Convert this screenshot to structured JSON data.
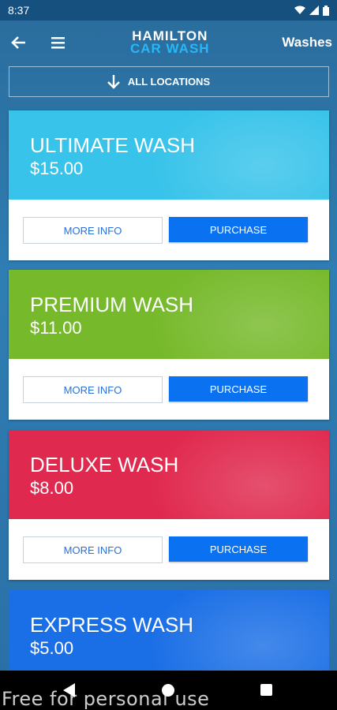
{
  "status": {
    "time": "8:37"
  },
  "header": {
    "logo_line1": "HAMILTON",
    "logo_line2": "CAR WASH",
    "title": "Washes"
  },
  "location": {
    "label": "ALL LOCATIONS"
  },
  "washes": [
    {
      "name": "ULTIMATE WASH",
      "price": "$15.00",
      "color": "#37c3ea",
      "more_label": "MORE INFO",
      "buy_label": "PURCHASE"
    },
    {
      "name": "PREMIUM WASH",
      "price": "$11.00",
      "color": "#76b92a",
      "more_label": "MORE INFO",
      "buy_label": "PURCHASE"
    },
    {
      "name": "DELUXE WASH",
      "price": "$8.00",
      "color": "#e0294e",
      "more_label": "MORE INFO",
      "buy_label": "PURCHASE"
    },
    {
      "name": "EXPRESS WASH",
      "price": "$5.00",
      "color": "#1b6fe6"
    }
  ],
  "icons": {
    "back": "arrow-left-icon",
    "menu": "hamburger-menu-icon",
    "location": "arrow-down-icon",
    "wifi": "wifi-icon",
    "signal": "signal-icon",
    "battery": "battery-icon"
  },
  "footer": {
    "watermark": "Free for personal use"
  }
}
